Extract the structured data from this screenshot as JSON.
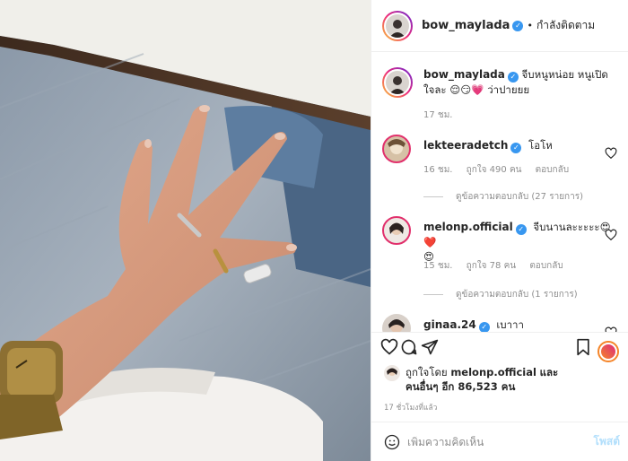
{
  "post": {
    "author": "bow_maylada",
    "follow_state": "กำลังติดตาม",
    "caption_part1": "จีบหนูหน่อย หนูเปิดใจละ",
    "caption_emoji": "😌😏💗",
    "caption_part2": "ว่าปายยย",
    "caption_time": "17 ชม."
  },
  "comments": [
    {
      "user": "lekteeradetch",
      "text": "โอโห",
      "time": "16 ชม.",
      "likes": "ถูกใจ 490 คน",
      "reply": "ตอบกลับ",
      "view_replies": "ดูข้อความตอบกลับ (27 รายการ)"
    },
    {
      "user": "melonp.official",
      "text": "จีบนานละะะะะ😍❤️",
      "text_emoji_line2": "😍",
      "time": "15 ชม.",
      "likes": "ถูกใจ 78 คน",
      "reply": "ตอบกลับ",
      "view_replies": "ดูข้อความตอบกลับ (1 รายการ)"
    },
    {
      "user": "ginaa.24",
      "text": "เบาาา"
    }
  ],
  "actions": {
    "liked_by_prefix": "ถูกใจโดย",
    "liked_by_user": "melonp.official",
    "liked_by_and": "และ",
    "others_prefix": "คนอื่นๆ อีก",
    "others_count": "86,523",
    "others_suffix": "คน",
    "posted_time": "17 ชั่วโมงที่แล้ว"
  },
  "add_comment": {
    "placeholder": "เพิ่มความคิดเห็น",
    "post_label": "โพสต์"
  },
  "icons": {
    "verified": "verified-badge-icon",
    "like": "heart-icon",
    "comment": "comment-icon",
    "share": "paper-plane-icon",
    "save": "bookmark-icon",
    "emoji": "smiley-icon"
  },
  "colors": {
    "verified": "#3897f0",
    "muted": "#8e8e8e",
    "post_button_disabled": "#b2dffc"
  }
}
